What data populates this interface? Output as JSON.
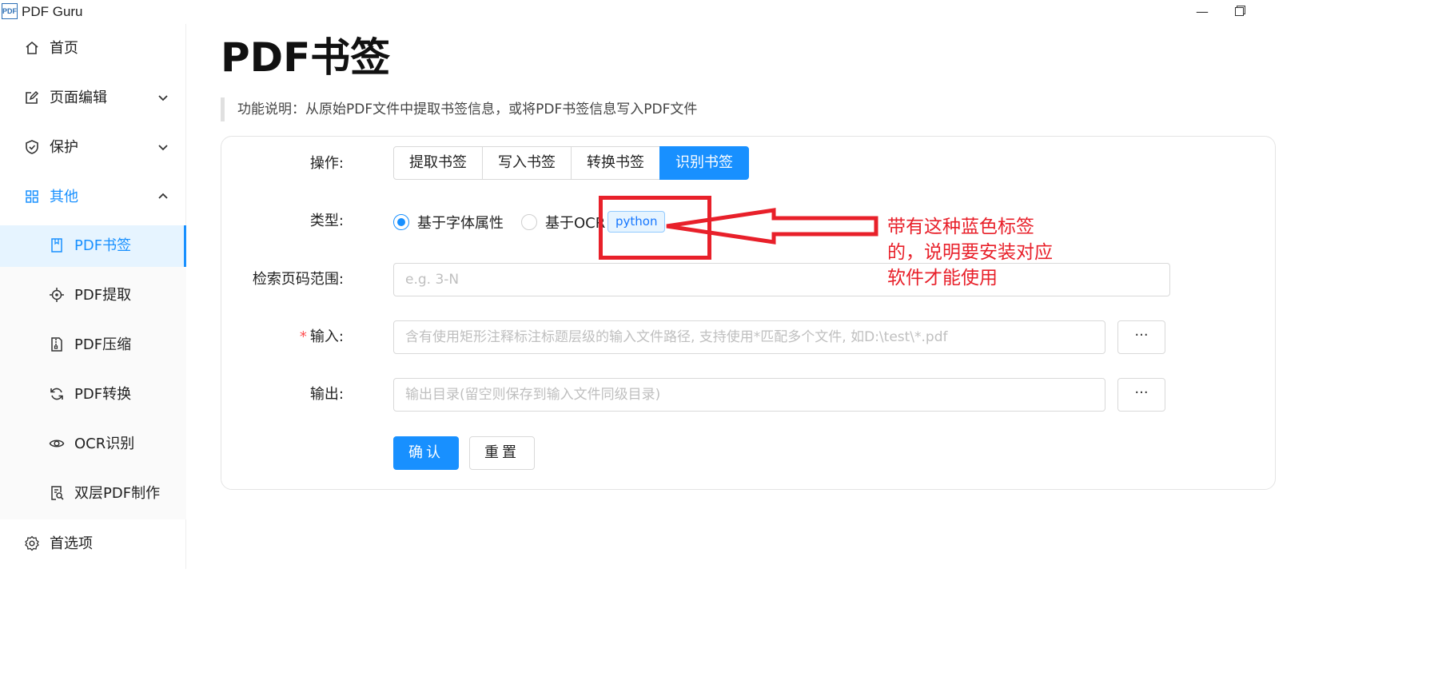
{
  "app": {
    "title": "PDF Guru",
    "logo_text": "PDF"
  },
  "window": {
    "minimize": "—"
  },
  "sidebar": {
    "items": [
      {
        "label": "首页",
        "icon": "home-icon"
      },
      {
        "label": "页面编辑",
        "icon": "edit-icon",
        "expandable": true
      },
      {
        "label": "保护",
        "icon": "shield-icon",
        "expandable": true
      },
      {
        "label": "其他",
        "icon": "grid-icon",
        "expanded": true
      }
    ],
    "sub_items": [
      {
        "label": "PDF书签",
        "icon": "bookmark-icon",
        "selected": true
      },
      {
        "label": "PDF提取",
        "icon": "target-icon"
      },
      {
        "label": "PDF压缩",
        "icon": "zip-icon"
      },
      {
        "label": "PDF转换",
        "icon": "sync-icon"
      },
      {
        "label": "OCR识别",
        "icon": "eye-icon"
      },
      {
        "label": "双层PDF制作",
        "icon": "file-search-icon"
      }
    ],
    "footer": {
      "label": "首选项",
      "icon": "gear-icon"
    }
  },
  "main": {
    "title": "PDF书签",
    "description": "功能说明：从原始PDF文件中提取书签信息，或将PDF书签信息写入PDF文件",
    "form": {
      "operation_label": "操作:",
      "operations": [
        "提取书签",
        "写入书签",
        "转换书签",
        "识别书签"
      ],
      "selected_operation": "识别书签",
      "type_label": "类型:",
      "type_options": [
        "基于字体属性",
        "基于OCR"
      ],
      "selected_type": "基于字体属性",
      "type_tag": "python",
      "page_range_label": "检索页码范围:",
      "page_range_placeholder": "e.g. 3-N",
      "input_label": "输入:",
      "input_required_mark": "*",
      "input_placeholder": "含有使用矩形注释标注标题层级的输入文件路径, 支持使用*匹配多个文件, 如D:\\test\\*.pdf",
      "output_label": "输出:",
      "output_placeholder": "输出目录(留空则保存到输入文件同级目录)",
      "browse_label": "···",
      "confirm_label": "确认",
      "reset_label": "重置"
    }
  },
  "annotation": {
    "text": "带有这种蓝色标签的，说明要安装对应软件才能使用",
    "color": "#e8202a"
  },
  "colors": {
    "accent": "#1890ff",
    "annotation": "#e8202a"
  }
}
